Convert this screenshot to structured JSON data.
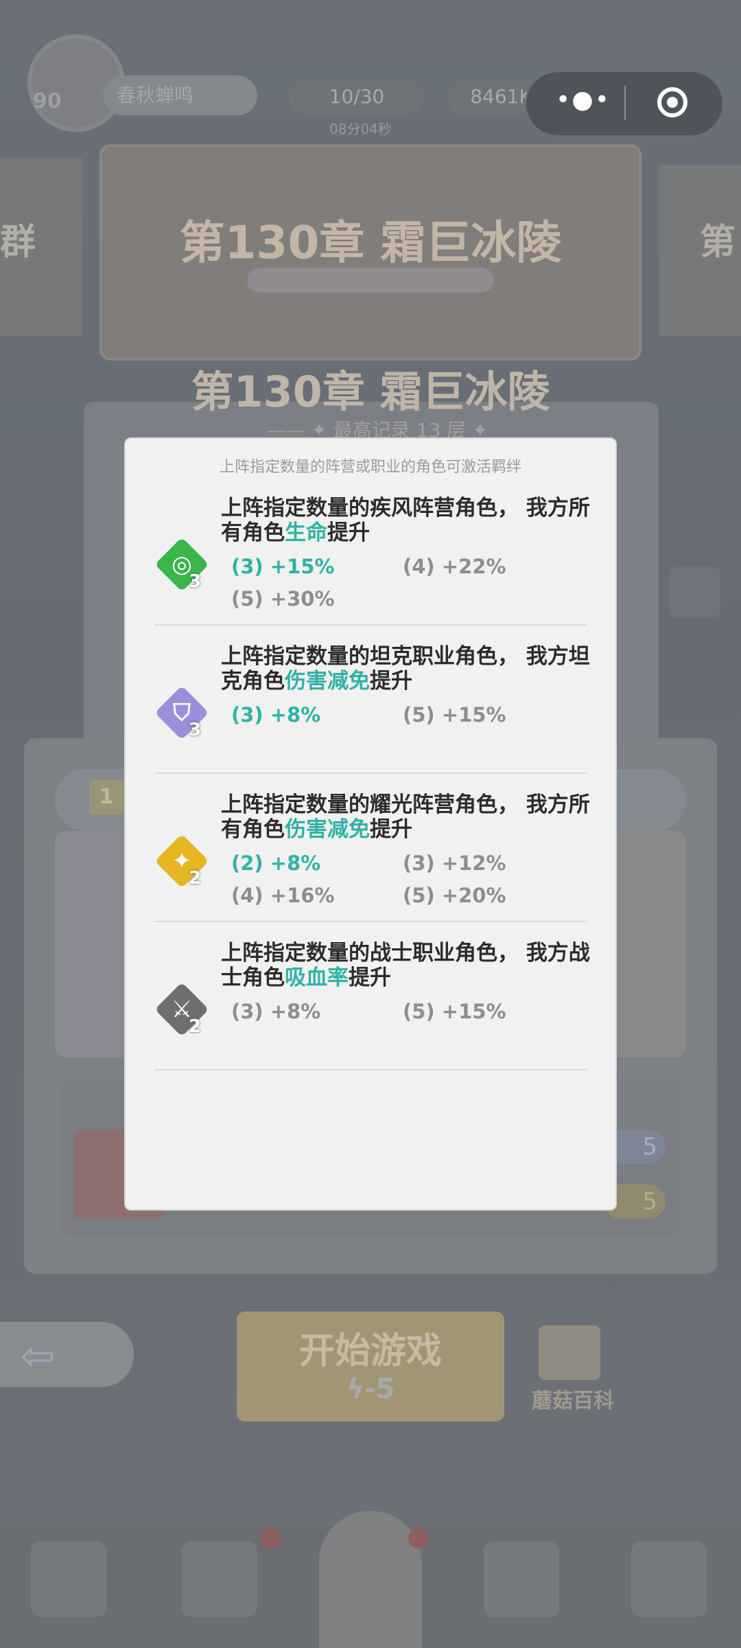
{
  "hud": {
    "level": "90",
    "player_name": "春秋蝉鸣",
    "energy": "10/30",
    "energy_timer": "08分04秒",
    "gems": "8461K"
  },
  "capsule": {
    "more": "•●•"
  },
  "background": {
    "banner_title": "第130章 霜巨冰陵",
    "side_left": "群",
    "side_right": "第",
    "chapter_title": "第130章 霜巨冰陵",
    "record": "—— ✦ 最高记录 13 层 ✦ ——",
    "badge_left": "1",
    "pill_blue": "5",
    "pill_yellow": "5",
    "start_label": "开始游戏",
    "start_cost": "-5",
    "wiki_label": "蘑菇百科"
  },
  "modal": {
    "hint": "上阵指定数量的阵营或职业的角色可激活羁绊",
    "entries": [
      {
        "icon": "wind-faction-icon",
        "color": "#39b54a",
        "count": "3",
        "desc_pre": "上阵指定数量的疾风阵营角色， 我方所有角色",
        "desc_hl": "生命",
        "desc_post": "提升",
        "tiers": [
          {
            "label": "(3) +15%",
            "active": true
          },
          {
            "label": "(4) +22%",
            "active": false
          },
          {
            "label": "(5) +30%",
            "active": false
          }
        ]
      },
      {
        "icon": "tank-class-icon",
        "color": "#9a8fd8",
        "count": "3",
        "desc_pre": "上阵指定数量的坦克职业角色， 我方坦克角色",
        "desc_hl": "伤害减免",
        "desc_post": "提升",
        "tiers": [
          {
            "label": "(3) +8%",
            "active": true
          },
          {
            "label": "(5) +15%",
            "active": false
          }
        ]
      },
      {
        "icon": "radiance-faction-icon",
        "color": "#e6b623",
        "count": "2",
        "desc_pre": "上阵指定数量的耀光阵营角色， 我方所有角色",
        "desc_hl": "伤害减免",
        "desc_post": "提升",
        "tiers": [
          {
            "label": "(2) +8%",
            "active": true
          },
          {
            "label": "(3) +12%",
            "active": false
          },
          {
            "label": "(4) +16%",
            "active": false
          },
          {
            "label": "(5) +20%",
            "active": false
          }
        ]
      },
      {
        "icon": "warrior-class-icon",
        "color": "#6f6f6f",
        "count": "2",
        "desc_pre": "上阵指定数量的战士职业角色， 我方战士角色",
        "desc_hl": "吸血率",
        "desc_post": "提升",
        "tiers": [
          {
            "label": "(3) +8%",
            "active": false
          },
          {
            "label": "(5) +15%",
            "active": false
          }
        ]
      }
    ]
  }
}
